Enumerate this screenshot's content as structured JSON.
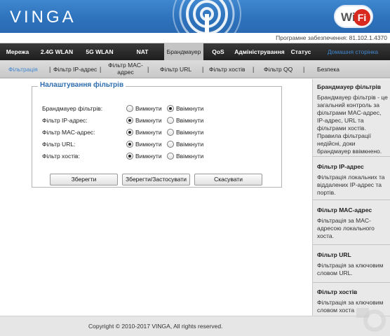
{
  "header": {
    "logo": "VINGA",
    "wifi_badge_left": "Wi",
    "wifi_badge_right": "Fi",
    "firmware": "Програмне забезпечення: 81.102.1.4370"
  },
  "main_nav": [
    {
      "label": "Мережа"
    },
    {
      "label": "2.4G WLAN"
    },
    {
      "label": "5G WLAN"
    },
    {
      "label": "NAT"
    },
    {
      "label": "Брандмауер"
    },
    {
      "label": "QoS"
    },
    {
      "label": "Адміністрування"
    },
    {
      "label": "Статус"
    },
    {
      "label": "Домашня сторінка"
    }
  ],
  "sub_nav": [
    {
      "label": "Фільтрація"
    },
    {
      "label": "Фільтр IP-адрес"
    },
    {
      "label": "Фільтр MAC-адрес"
    },
    {
      "label": "Фільтр URL"
    },
    {
      "label": "Фільтр хостів"
    },
    {
      "label": "Фільтр QQ"
    },
    {
      "label": "Безпека"
    }
  ],
  "form": {
    "title": "Налаштування фільтрів",
    "off_label": "Вимкнути",
    "on_label": "Ввімкнути",
    "rows": [
      {
        "label": "Брандмауер фільтрів:",
        "value": "Ввімкнути"
      },
      {
        "label": "Фільтр IP-адрес:",
        "value": "Вимкнути"
      },
      {
        "label": "Фільтр MAC-адрес:",
        "value": "Вимкнути"
      },
      {
        "label": "Фільтр URL:",
        "value": "Вимкнути"
      },
      {
        "label": "Фільтр хостів:",
        "value": "Вимкнути"
      }
    ],
    "buttons": {
      "save": "Зберегти",
      "save_apply": "Зберегти/Застосувати",
      "cancel": "Скасувати"
    }
  },
  "help": [
    {
      "title": "Брандмауер фільтрів",
      "text": "Брандмауер фільтрів - це загальний контроль за фільтрами MAC-адрес, IP-адрес, URL та фільтрами хостів. Правила фільтрації недійсні, доки брандмауер ввімкнено."
    },
    {
      "title": "Фільтр IP-адрес",
      "text": "Фільтрація локальних та віддалених IP-адрес та портів."
    },
    {
      "title": "Фільтр MAC-адрес",
      "text": "Фільтрація за MAC-адресою локального хоста."
    },
    {
      "title": "Фільтр URL",
      "text": "Фільтрація за ключовим словом URL."
    },
    {
      "title": "Фільтр хостів",
      "text": "Фільтрація за ключовим словом хоста"
    }
  ],
  "footer": {
    "copyright": "Copyright © 2010-2017 VINGA, All rights reserved."
  }
}
